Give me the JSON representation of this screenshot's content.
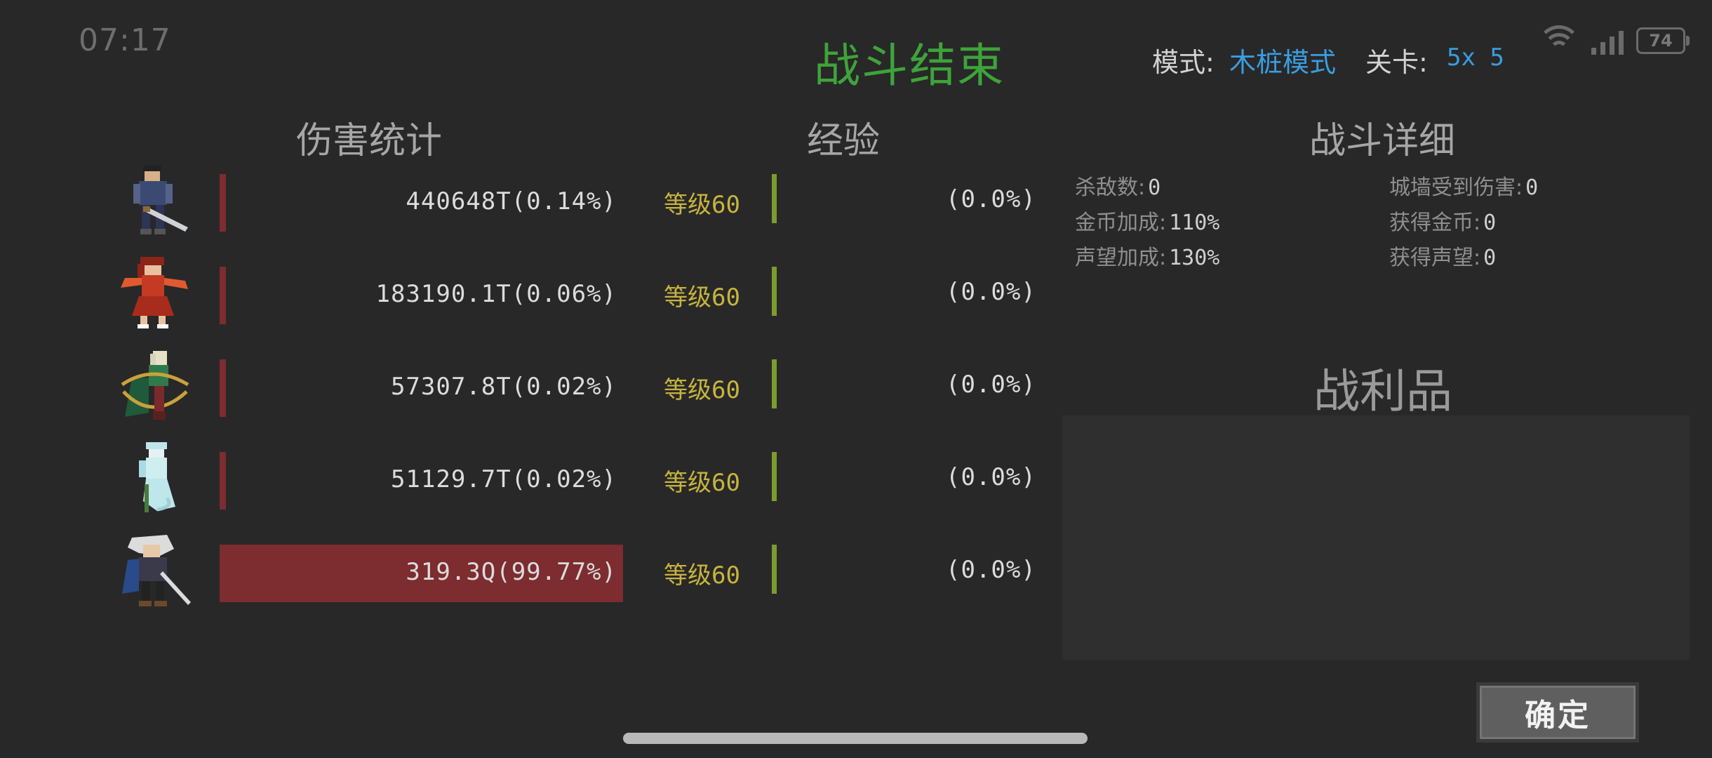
{
  "status_bar": {
    "time": "07:17",
    "battery": "74"
  },
  "header": {
    "title": "战斗结束",
    "mode_label": "模式:",
    "mode_value": "木桩模式",
    "level_label": "关卡:",
    "level_value": "5x 5"
  },
  "damage": {
    "title": "伤害统计",
    "rows": [
      {
        "portrait": "hero-swordsman-dark",
        "text": "440648T(0.14%)",
        "share": 0.14
      },
      {
        "portrait": "hero-red-dancer",
        "text": "183190.1T(0.06%)",
        "share": 0.06
      },
      {
        "portrait": "hero-archer-green",
        "text": "57307.8T(0.02%)",
        "share": 0.02
      },
      {
        "portrait": "hero-ghost-white",
        "text": "51129.7T(0.02%)",
        "share": 0.02
      },
      {
        "portrait": "hero-white-hair-swordsman",
        "text": "319.3Q(99.77%)",
        "share": 99.77
      }
    ]
  },
  "experience": {
    "title": "经验",
    "rows": [
      {
        "level": "等级60",
        "text": "(0.0%)"
      },
      {
        "level": "等级60",
        "text": "(0.0%)"
      },
      {
        "level": "等级60",
        "text": "(0.0%)"
      },
      {
        "level": "等级60",
        "text": "(0.0%)"
      },
      {
        "level": "等级60",
        "text": "(0.0%)"
      }
    ]
  },
  "details": {
    "title": "战斗详细",
    "kills_label": "杀敌数:",
    "kills": "0",
    "gold_bonus_label": "金币加成:",
    "gold_bonus": "110%",
    "fame_bonus_label": "声望加成:",
    "fame_bonus": "130%",
    "wall_damage_label": "城墙受到伤害:",
    "wall_damage": "0",
    "gold_gain_label": "获得金币:",
    "gold_gain": "0",
    "fame_gain_label": "获得声望:",
    "fame_gain": "0"
  },
  "loot": {
    "title": "战利品"
  },
  "confirm_label": "确定",
  "colors": {
    "title": "#3ea33a",
    "link": "#3a9de0",
    "level": "#c7b43e",
    "damage_bar": "#7d2c2f",
    "exp_bar": "#7c9c2d"
  }
}
